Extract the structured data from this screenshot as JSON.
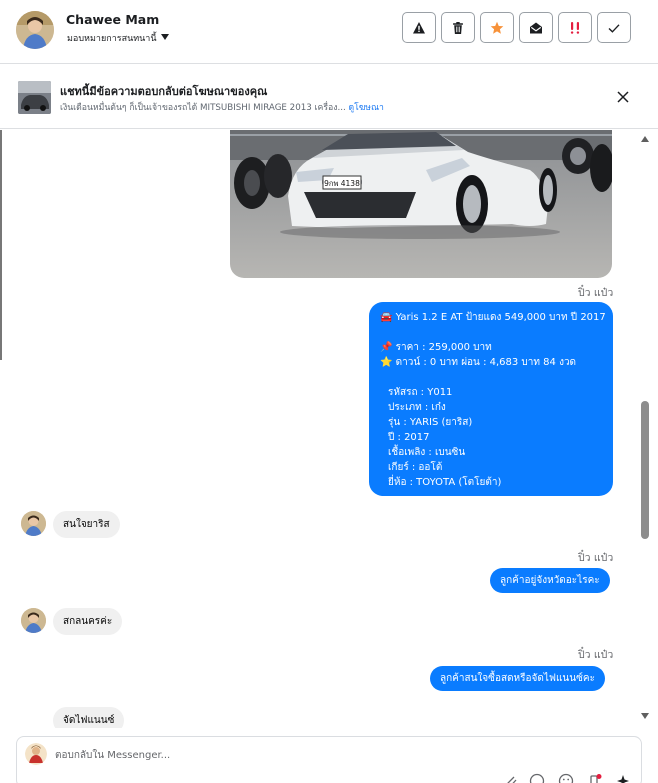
{
  "header": {
    "contact_name": "Chawee Mam",
    "assign_label": "มอบหมายการสนทนานี้",
    "actions": [
      "alert-icon",
      "trash-icon",
      "star-icon",
      "envelope-open-icon",
      "spam-icon",
      "check-icon"
    ],
    "colors": {
      "star": "#f7923a",
      "spam": "#e41e3f"
    }
  },
  "ad": {
    "title": "แชทนี้มีข้อความตอบกลับต่อโฆษณาของคุณ",
    "description": "เงินเดือนหมื่นต้นๆ ก็เป็นเจ้าของรถได้ MITSUBISHI MIRAGE 2013 เครื่อง...",
    "link": "ดูโฆษณา"
  },
  "messages": {
    "sender_1": "ปิ๋ว แป๋ว",
    "listing": {
      "headline": "🚘 Yaris 1.2 E AT ป้ายแดง 549,000 บาท ปี 2017",
      "price": "📌 ราคา : 259,000 บาท",
      "terms": "⭐ ดาวน์ : 0 บาท ผ่อน : 4,683 บาท 84 งวด",
      "code": "รหัสรถ : Y011",
      "type": "ประเภท : เก๋ง",
      "model": "รุ่น : YARIS (ยาริส)",
      "year": "ปี : 2017",
      "fuel": "เชื้อเพลิง : เบนซิน",
      "gear": "เกียร์ : ออโต้",
      "brand": "ยี่ห้อ : TOYOTA (โตโยต้า)"
    },
    "in_1": "สนใจยาริส",
    "sender_2": "ปิ๋ว แป๋ว",
    "out_2": "ลูกค้าอยู่จังหวัดอะไรคะ",
    "in_2": "สกลนครค่ะ",
    "sender_3": "ปิ๋ว แป๋ว",
    "out_3": "ลูกค้าสนใจซื้อสดหรือจัดไฟแนนซ์คะ",
    "in_3": "จัดไฟแนนซ์"
  },
  "composer": {
    "placeholder": "ตอบกลับใน Messenger...",
    "tools": [
      "attach-icon",
      "gif-icon",
      "emoji-icon",
      "saved-reply-icon",
      "magic-icon"
    ]
  },
  "image": {
    "plate": "9กพ 4138"
  }
}
